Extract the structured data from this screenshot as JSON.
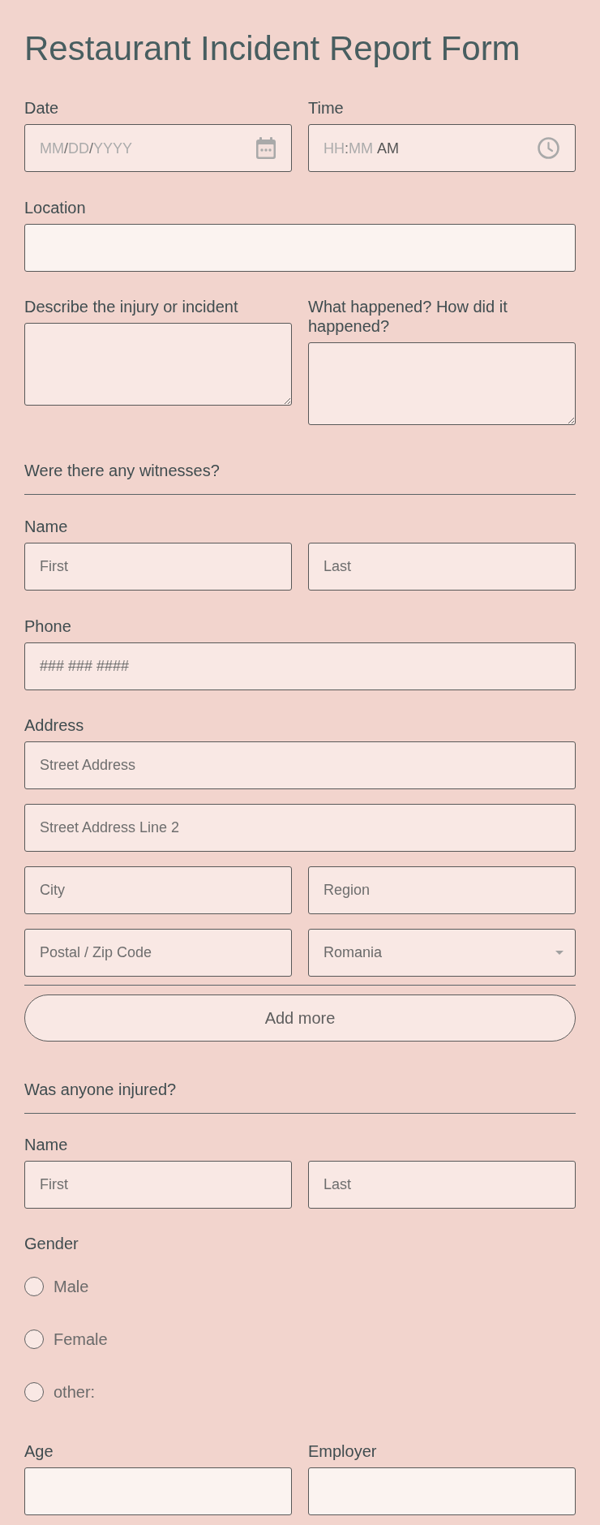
{
  "title": "Restaurant Incident Report Form",
  "date": {
    "label": "Date",
    "placeholder_parts": [
      "MM",
      "DD",
      "YYYY"
    ],
    "separator": "/"
  },
  "time": {
    "label": "Time",
    "placeholder_parts": [
      "HH",
      "MM"
    ],
    "separator": ":",
    "period": "AM"
  },
  "location": {
    "label": "Location"
  },
  "descriptions": [
    {
      "label": "Describe the injury or incident"
    },
    {
      "label": "What happened? How did it happened?"
    }
  ],
  "witnesses": {
    "heading": "Were there any witnesses?",
    "name": {
      "label": "Name",
      "first": {
        "placeholder": "First"
      },
      "last": {
        "placeholder": "Last"
      }
    },
    "phone": {
      "label": "Phone",
      "placeholder": "### ### ####"
    },
    "address": {
      "label": "Address",
      "street": {
        "placeholder": "Street Address"
      },
      "street2": {
        "placeholder": "Street Address Line 2"
      },
      "city": {
        "placeholder": "City"
      },
      "region": {
        "placeholder": "Region"
      },
      "postal": {
        "placeholder": "Postal / Zip Code"
      },
      "country": {
        "value": "Romania"
      }
    },
    "add_button": "Add more"
  },
  "injured": {
    "heading": "Was anyone injured?",
    "name": {
      "label": "Name",
      "first": {
        "placeholder": "First"
      },
      "last": {
        "placeholder": "Last"
      }
    },
    "gender": {
      "label": "Gender",
      "options": [
        {
          "label": "Male",
          "selected": false
        },
        {
          "label": "Female",
          "selected": false
        },
        {
          "label": "other:",
          "selected": false
        }
      ]
    },
    "age": {
      "label": "Age"
    },
    "employer": {
      "label": "Employer"
    }
  }
}
